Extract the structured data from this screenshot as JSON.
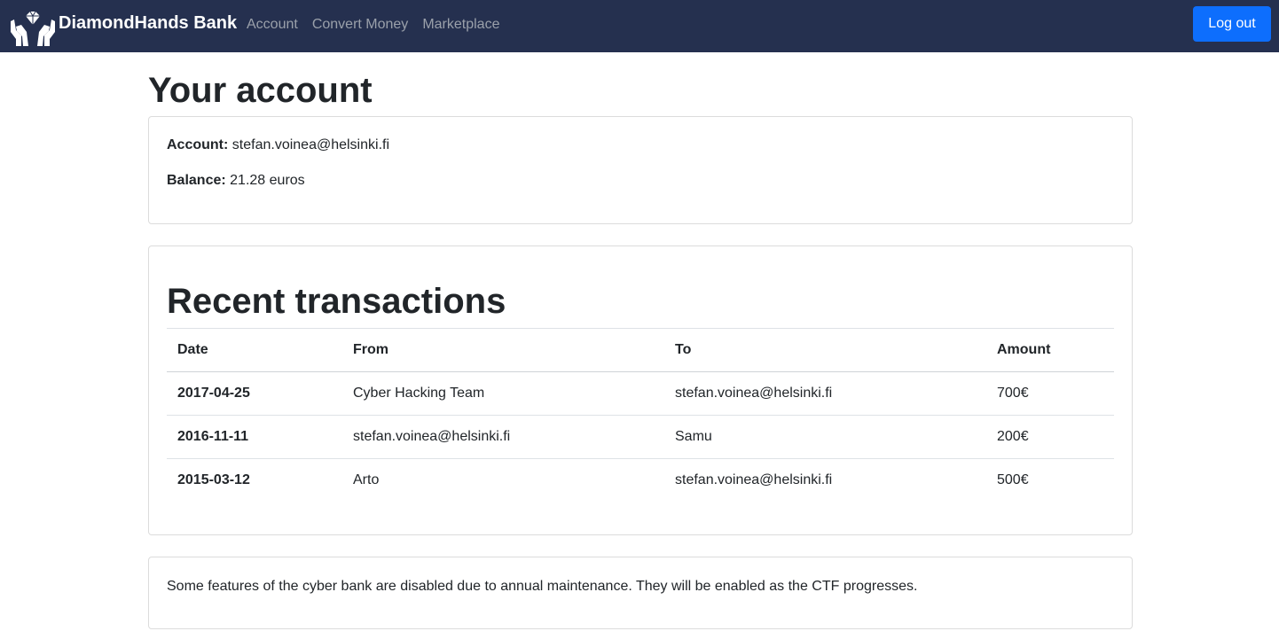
{
  "nav": {
    "brand": "DiamondHands Bank",
    "links": [
      "Account",
      "Convert Money",
      "Marketplace"
    ],
    "logout_label": "Log out",
    "logo_icon": "diamond-hands-icon",
    "colors": {
      "navbar": "#25304f",
      "button": "#0d6efd"
    }
  },
  "page": {
    "title": "Your account"
  },
  "account": {
    "account_label": "Account:",
    "account_value": "stefan.voinea@helsinki.fi",
    "balance_label": "Balance:",
    "balance_value": "21.28 euros"
  },
  "transactions": {
    "title": "Recent transactions",
    "headers": {
      "date": "Date",
      "from": "From",
      "to": "To",
      "amount": "Amount"
    },
    "rows": [
      {
        "date": "2017-04-25",
        "from": "Cyber Hacking Team",
        "to": "stefan.voinea@helsinki.fi",
        "amount": "700€"
      },
      {
        "date": "2016-11-11",
        "from": "stefan.voinea@helsinki.fi",
        "to": "Samu",
        "amount": "200€"
      },
      {
        "date": "2015-03-12",
        "from": "Arto",
        "to": "stefan.voinea@helsinki.fi",
        "amount": "500€"
      }
    ]
  },
  "notice": {
    "text": "Some features of the cyber bank are disabled due to annual maintenance. They will be enabled as the CTF progresses."
  }
}
